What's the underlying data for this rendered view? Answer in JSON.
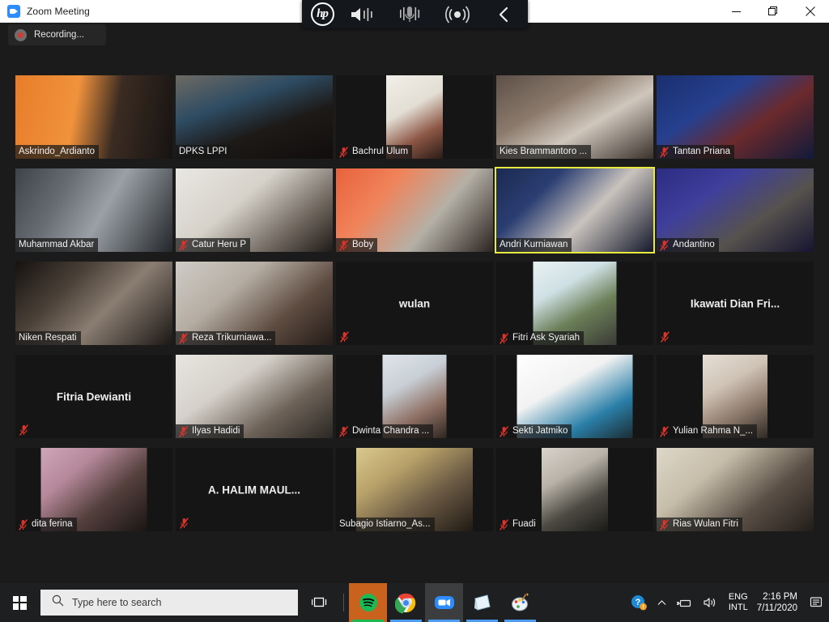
{
  "window": {
    "title": "Zoom Meeting",
    "app_icon": "zoom-camera-icon",
    "minimize_label": "Minimize",
    "maximize_label": "Restore",
    "close_label": "Close"
  },
  "hp_toolbar": {
    "logo": "hp",
    "buttons": [
      {
        "name": "speaker-volume-icon",
        "label": "Speaker"
      },
      {
        "name": "microphone-icon",
        "label": "Microphone"
      },
      {
        "name": "broadcast-icon",
        "label": "Broadcast"
      },
      {
        "name": "chevron-left-icon",
        "label": "Collapse"
      }
    ]
  },
  "toolbar": {
    "recording_label": "Recording..."
  },
  "gallery": {
    "participants": [
      {
        "name": "Askrindo_Ardianto",
        "video": true,
        "muted": false,
        "active": false,
        "bg": "linear-gradient(100deg,#e87d2a 0%,#f0923c 38%,#3b2c22 63%,#171312 100%)",
        "vw": 194,
        "vx": 0
      },
      {
        "name": "DPKS LPPI",
        "video": true,
        "muted": false,
        "active": false,
        "bg": "linear-gradient(160deg,#6d6a63 0%,#2e4c63 34%,#1d1a18 62%,#100d0c 100%)",
        "vw": 194,
        "vx": 0
      },
      {
        "name": "Bachrul Ulum",
        "video": true,
        "muted": true,
        "active": false,
        "bg": "linear-gradient(150deg,#f2efe9 0%,#e3ded4 40%,#8d5746 70%,#2a1b16 100%)",
        "vw": 70,
        "vx": 57
      },
      {
        "name": "Kies Brammantoro ...",
        "video": true,
        "muted": false,
        "active": false,
        "bg": "linear-gradient(150deg,#5d5048 0%,#8b7a6c 35%,#cfc6bc 60%,#3a312c 100%)",
        "vw": 194,
        "vx": 0
      },
      {
        "name": "Tantan Priana",
        "video": true,
        "muted": true,
        "active": false,
        "bg": "linear-gradient(145deg,#1a2f6e 0%,#26408f 35%,#6b2a2c 62%,#101a3a 100%)",
        "vw": 194,
        "vx": 0
      },
      {
        "name": "Muhammad Akbar",
        "video": true,
        "muted": false,
        "active": false,
        "bg": "linear-gradient(120deg,#3d4349 0%,#676d73 30%,#9aa0a6 55%,#23262a 100%)",
        "vw": 194,
        "vx": 0
      },
      {
        "name": "Catur Heru P",
        "video": true,
        "muted": true,
        "active": false,
        "bg": "linear-gradient(140deg,#e9e7e2 0%,#d6d2ca 40%,#6b625a 75%,#1f1b18 100%)",
        "vw": 194,
        "vx": 0
      },
      {
        "name": "Boby",
        "video": true,
        "muted": true,
        "active": false,
        "bg": "linear-gradient(130deg,#e8623c 0%,#f0835a 30%,#b4b0a6 62%,#2b2320 100%)",
        "vw": 194,
        "vx": 0
      },
      {
        "name": "Andri Kurniawan",
        "video": true,
        "muted": false,
        "active": true,
        "bg": "linear-gradient(135deg,#1c2a52 0%,#2b3e72 28%,#c9c3bd 58%,#14182c 100%)",
        "vw": 194,
        "vx": 0
      },
      {
        "name": "Andantino",
        "video": true,
        "muted": true,
        "active": false,
        "bg": "linear-gradient(145deg,#2c2c82 0%,#3f3f9c 32%,#56524e 64%,#161430 100%)",
        "vw": 194,
        "vx": 0
      },
      {
        "name": "Niken Respati",
        "video": true,
        "muted": false,
        "active": false,
        "bg": "linear-gradient(135deg,#15120f 0%,#4b4138 32%,#8a7d72 58%,#1b1714 100%)",
        "vw": 194,
        "vx": 0
      },
      {
        "name": "Reza Trikurniawa...",
        "video": true,
        "muted": true,
        "active": false,
        "bg": "linear-gradient(140deg,#cfccc6 0%,#b5ada3 35%,#5e4c41 68%,#241c18 100%)",
        "vw": 194,
        "vx": 0
      },
      {
        "name": "wulan",
        "video": false,
        "muted": true,
        "active": false,
        "bg": "",
        "vw": 0,
        "vx": 0
      },
      {
        "name": "Fitri Ask Syariah",
        "video": true,
        "muted": true,
        "active": false,
        "bg": "linear-gradient(150deg,#e9f1f3 0%,#cfe0e4 32%,#6b7f58 62%,#3a3a36 100%)",
        "vw": 103,
        "vx": 46
      },
      {
        "name": "Ikawati Dian Fri...",
        "video": false,
        "muted": true,
        "active": false,
        "bg": "",
        "vw": 0,
        "vx": 0
      },
      {
        "name": "Fitria Dewianti",
        "video": false,
        "muted": true,
        "active": false,
        "bg": "",
        "vw": 0,
        "vx": 0
      },
      {
        "name": "Ilyas Hadidi",
        "video": true,
        "muted": true,
        "active": false,
        "bg": "linear-gradient(145deg,#e8e5e0 0%,#d5d1ca 35%,#6d6258 68%,#2b2723 100%)",
        "vw": 194,
        "vx": 0
      },
      {
        "name": "Dwinta Chandra ...",
        "video": true,
        "muted": true,
        "active": false,
        "bg": "linear-gradient(150deg,#dfe5ea 0%,#c8cfd6 35%,#8e6f63 68%,#2e2521 100%)",
        "vw": 79,
        "vx": 58
      },
      {
        "name": "Sekti Jatmiko",
        "video": true,
        "muted": true,
        "active": false,
        "bg": "linear-gradient(150deg,#ffffff 0%,#f2f2f2 38%,#2a7fa8 72%,#1c2c33 100%)",
        "vw": 143,
        "vx": 26
      },
      {
        "name": "Yulian Rahma N_...",
        "video": true,
        "muted": true,
        "active": false,
        "bg": "linear-gradient(150deg,#e6dfd6 0%,#cfc3b6 35%,#8d7a6c 66%,#2e2823 100%)",
        "vw": 80,
        "vx": 56
      },
      {
        "name": "dita ferina",
        "video": true,
        "muted": true,
        "active": false,
        "bg": "linear-gradient(140deg,#cfa7b8 0%,#b5889a 30%,#54403d 62%,#1a1514 100%)",
        "vw": 131,
        "vx": 32
      },
      {
        "name": "A. HALIM MAUL...",
        "video": false,
        "muted": true,
        "active": false,
        "bg": "",
        "vw": 0,
        "vx": 0
      },
      {
        "name": "Subagio Istiarno_As...",
        "video": true,
        "muted": false,
        "active": false,
        "bg": "linear-gradient(145deg,#d9c98e 0%,#b9a26a 30%,#6b5a44 62%,#201a14 100%)",
        "vw": 144,
        "vx": 25
      },
      {
        "name": "Fuadi",
        "video": true,
        "muted": true,
        "active": false,
        "bg": "linear-gradient(150deg,#d8d3cb 0%,#b8b2a8 34%,#4c4a42 66%,#1b1a16 100%)",
        "vw": 82,
        "vx": 56
      },
      {
        "name": "Rias Wulan Fitri",
        "video": true,
        "muted": true,
        "active": false,
        "bg": "linear-gradient(140deg,#ded7c9 0%,#c6bda9 32%,#5a4f46 66%,#221d19 100%)",
        "vw": 194,
        "vx": 0
      }
    ]
  },
  "taskbar": {
    "start_label": "Start",
    "search_placeholder": "Type here to search",
    "taskview_label": "Task View",
    "apps": [
      {
        "name": "spotify-taskbar-icon",
        "label": "Spotify",
        "accent": "#1db954",
        "tilebg": "#c8621c",
        "underline": "#1db954",
        "active": false
      },
      {
        "name": "chrome-taskbar-icon",
        "label": "Google Chrome",
        "accent": "#4285f4",
        "tilebg": "transparent",
        "underline": "#4d9bf0",
        "active": false
      },
      {
        "name": "zoom-taskbar-icon",
        "label": "Zoom",
        "accent": "#2d8cff",
        "tilebg": "#3b3d3e",
        "underline": "#4d9bf0",
        "active": true
      },
      {
        "name": "sticky-notes-taskbar-icon",
        "label": "Sticky Notes",
        "accent": "#cfe8f5",
        "tilebg": "transparent",
        "underline": "#4d9bf0",
        "active": false
      },
      {
        "name": "paint-taskbar-icon",
        "label": "Paint 3D",
        "accent": "#e8b13b",
        "tilebg": "transparent",
        "underline": "#4d9bf0",
        "active": false
      }
    ],
    "tray": {
      "help_icon": "help-question-icon",
      "chevron_label": "Show hidden icons",
      "network_icon": "network-icon",
      "volume_icon": "volume-icon",
      "language_line1": "ENG",
      "language_line2": "INTL",
      "time": "2:16 PM",
      "date": "7/11/2020",
      "notification_icon": "action-center-icon"
    }
  }
}
